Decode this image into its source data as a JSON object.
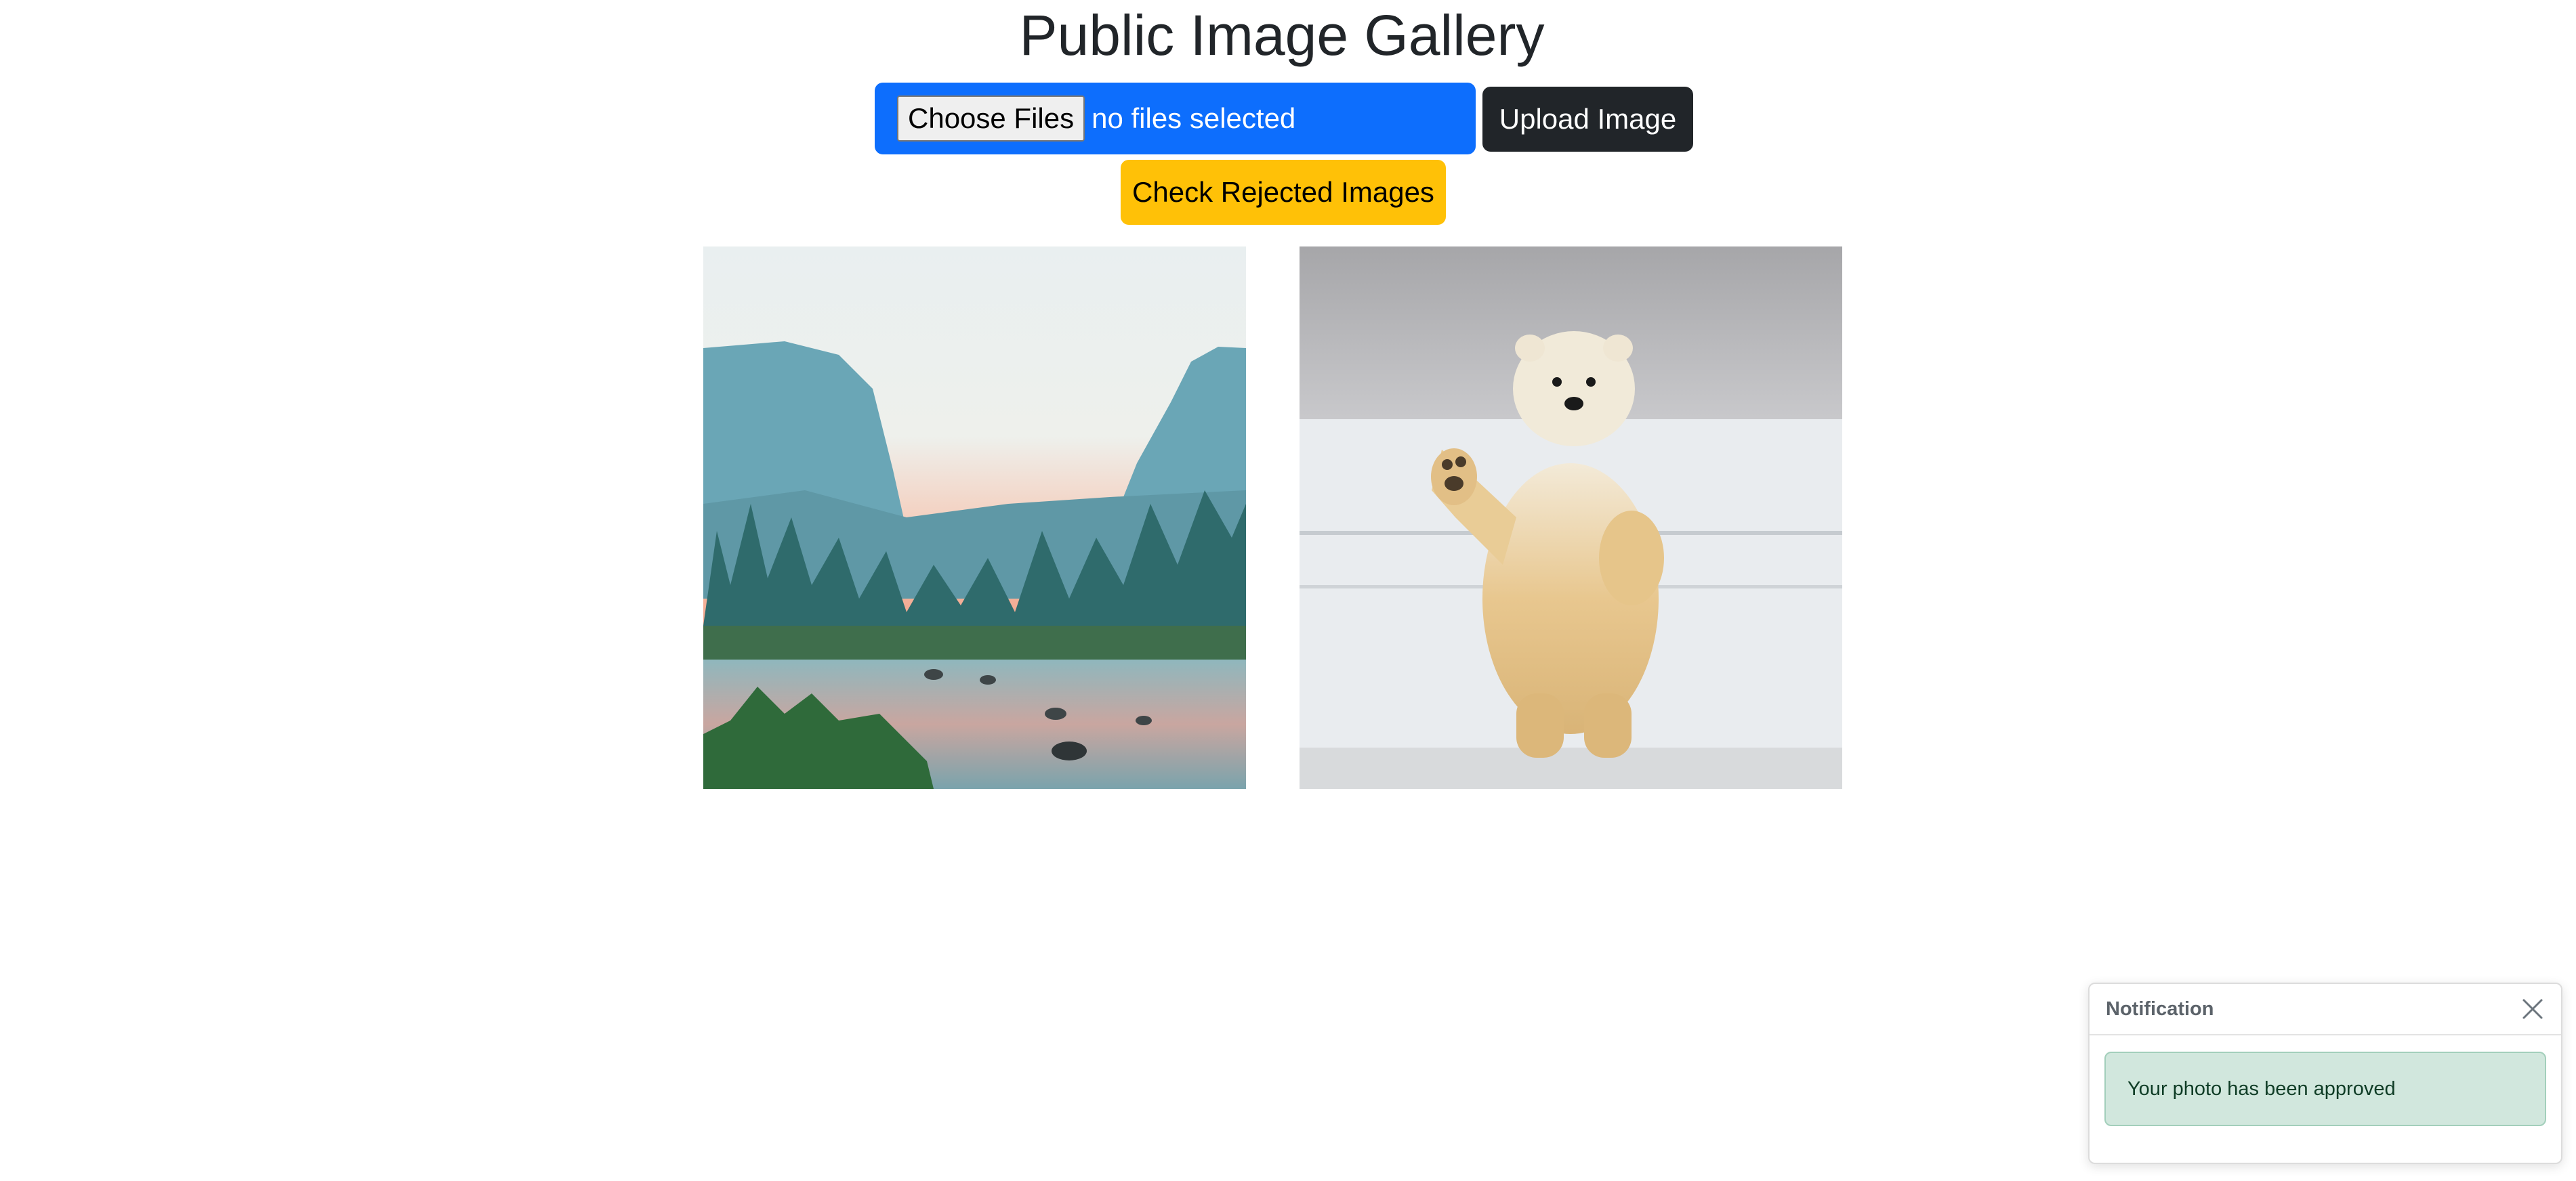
{
  "page": {
    "title": "Public Image Gallery"
  },
  "upload": {
    "choose_label": "Choose Files",
    "file_status": "no files selected",
    "upload_label": "Upload Image"
  },
  "actions": {
    "rejected_label": "Check Rejected Images"
  },
  "gallery": {
    "images": [
      {
        "icon": "landscape-photo-valley-river-sunrise"
      },
      {
        "icon": "polar-bear-waving-photo"
      }
    ]
  },
  "notification": {
    "title": "Notification",
    "message": "Your photo has been approved",
    "close_icon": "close-icon"
  },
  "colors": {
    "primary": "#0d6efd",
    "dark": "#212529",
    "warning": "#ffc107",
    "success_bg": "#d1e7dd"
  }
}
